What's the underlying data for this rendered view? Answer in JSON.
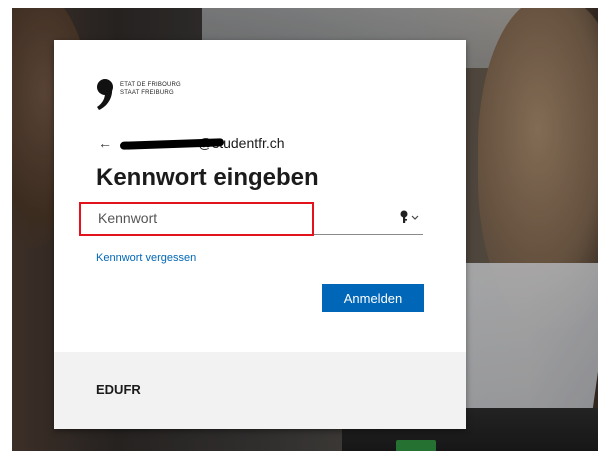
{
  "logo": {
    "line1": "ETAT DE FRIBOURG",
    "line2": "STAAT FREIBURG"
  },
  "identity": {
    "back_icon": "arrow-left-icon",
    "email_visible_part": "@studentfr.ch"
  },
  "title": "Kennwort eingeben",
  "password_field": {
    "placeholder": "Kennwort",
    "value": "",
    "icon": "key-icon"
  },
  "links": {
    "forgot_password": "Kennwort vergessen"
  },
  "buttons": {
    "sign_in": "Anmelden"
  },
  "footer": {
    "text": "EDUFR"
  },
  "colors": {
    "accent": "#0067b8",
    "highlight_border": "#e3121b",
    "footer_bg": "#f2f2f2"
  }
}
